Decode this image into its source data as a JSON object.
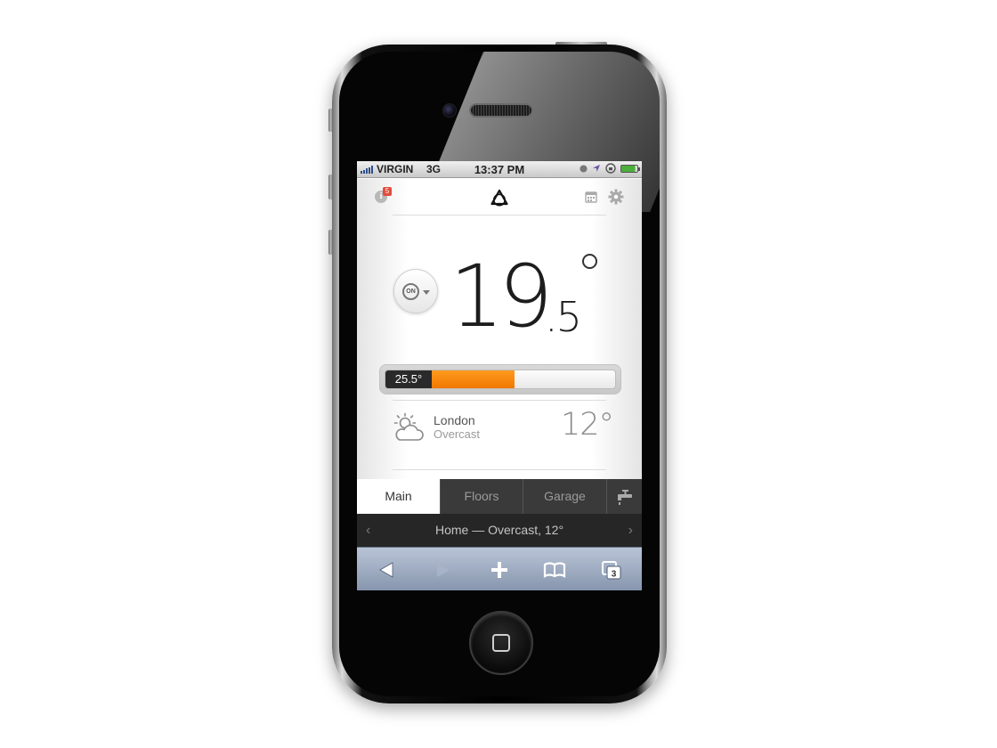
{
  "status_bar": {
    "carrier": "VIRGIN",
    "network": "3G",
    "time": "13:37 PM"
  },
  "app": {
    "notification_count": "5",
    "info_glyph": "i",
    "mode_label": "ON",
    "temperature": {
      "integer": "19",
      "decimal": ".5",
      "unit_icon": "degree-ring"
    },
    "target": {
      "label": "25.5°",
      "progress_fraction": 0.45,
      "accent_color": "#f07800"
    },
    "weather": {
      "city": "London",
      "condition": "Overcast",
      "temperature": "12°",
      "icon": "sun-cloud-icon"
    }
  },
  "tabs": [
    {
      "label": "Main",
      "active": true
    },
    {
      "label": "Floors",
      "active": false
    },
    {
      "label": "Garage",
      "active": false
    }
  ],
  "page_title_bar": {
    "text": "Home — Overcast, 12°",
    "prev": "‹",
    "next": "›"
  },
  "browser_toolbar": {
    "tabs_count": "3",
    "icons": [
      "back-icon",
      "forward-icon",
      "add-icon",
      "bookmarks-icon",
      "pages-icon"
    ]
  }
}
